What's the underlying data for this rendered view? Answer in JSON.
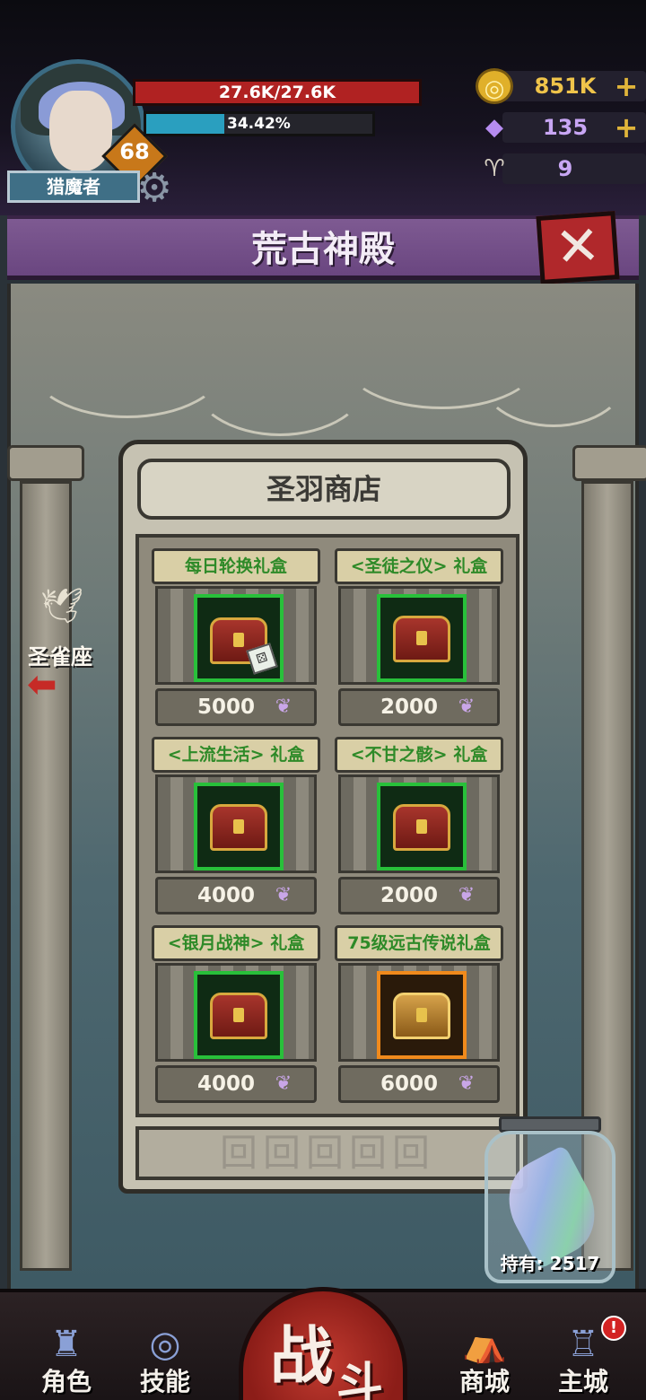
{
  "player": {
    "name": "猎魔者",
    "level": "68",
    "hp_text": "27.6K/27.6K",
    "xp_text": "34.42%",
    "xp_fraction": 0.3442
  },
  "resources": {
    "gold": {
      "value": "851K",
      "icon": "gold-coin-icon",
      "has_plus": true
    },
    "gems": {
      "value": "135",
      "icon": "purple-crystal-icon",
      "has_plus": true
    },
    "horns": {
      "value": "9",
      "icon": "ram-skull-icon",
      "has_plus": false
    },
    "plus_symbol": "+"
  },
  "title": "荒古神殿",
  "close_symbol": "✕",
  "left_nav": {
    "label": "圣雀座",
    "arrow": "⬅"
  },
  "shop": {
    "title": "圣羽商店",
    "currency_icon": "feather-icon",
    "items": [
      {
        "name": "每日轮换礼盒",
        "price": "5000",
        "rarity": "green",
        "has_dice": true
      },
      {
        "name": "<圣徒之仪> 礼盒",
        "price": "2000",
        "rarity": "green",
        "has_dice": false
      },
      {
        "name": "<上流生活> 礼盒",
        "price": "4000",
        "rarity": "green",
        "has_dice": false
      },
      {
        "name": "<不甘之骸> 礼盒",
        "price": "2000",
        "rarity": "green",
        "has_dice": false
      },
      {
        "name": "<银月战神> 礼盒",
        "price": "4000",
        "rarity": "green",
        "has_dice": false
      },
      {
        "name": "75级远古传说礼盒",
        "price": "6000",
        "rarity": "orange",
        "has_dice": false
      }
    ]
  },
  "holdings": {
    "label": "持有: 2517"
  },
  "bottom_nav": {
    "items": [
      {
        "label": "角色",
        "icon": "character-helmet-icon"
      },
      {
        "label": "技能",
        "icon": "skill-swirl-icon"
      },
      {
        "label": "商城",
        "icon": "shop-tent-icon"
      },
      {
        "label": "主城",
        "icon": "castle-icon"
      }
    ],
    "fight": {
      "char1": "战",
      "char2": "斗"
    },
    "alert": "!"
  }
}
